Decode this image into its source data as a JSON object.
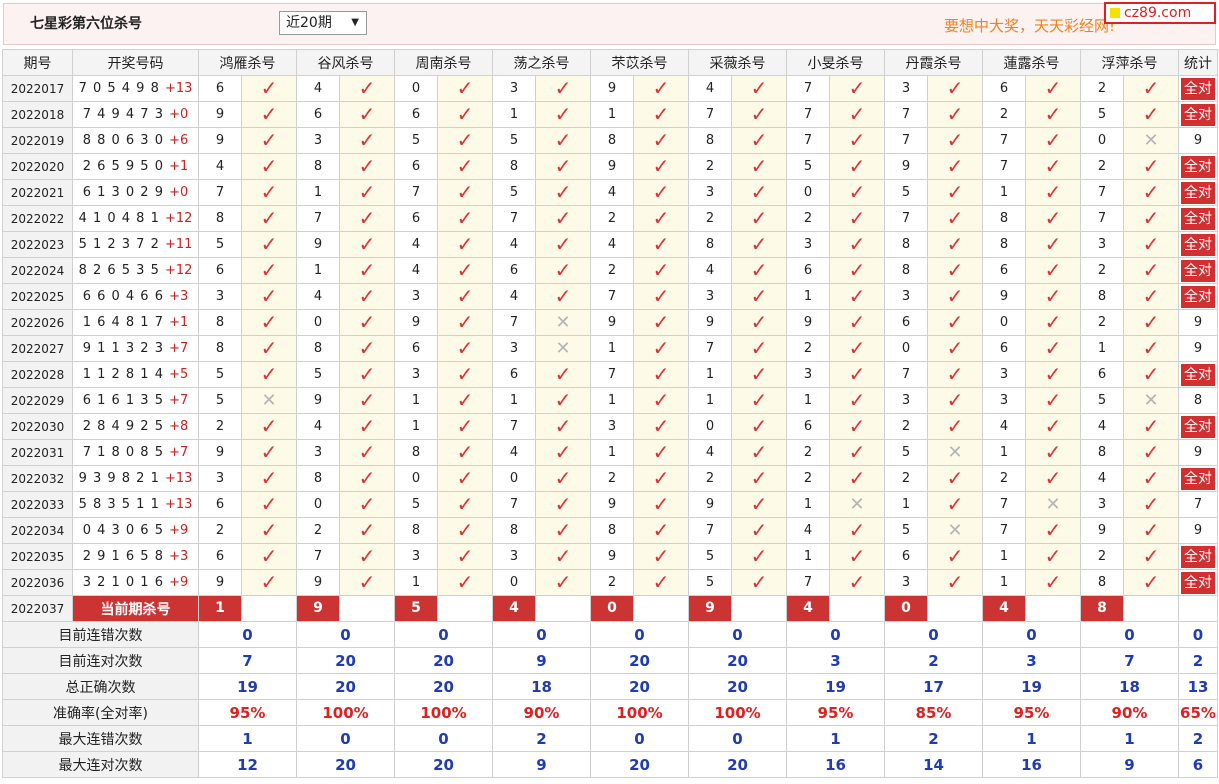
{
  "header": {
    "title": "七星彩第六位杀号",
    "period_select": "近20期",
    "slogan": "要想中大奖，天天彩经网!",
    "logo": "cz89.com"
  },
  "table": {
    "col_issue": "期号",
    "col_draw": "开奖号码",
    "col_stat": "统计",
    "experts": [
      "鸿雁杀号",
      "谷风杀号",
      "周南杀号",
      "荡之杀号",
      "芣苡杀号",
      "采薇杀号",
      "小旻杀号",
      "丹霞杀号",
      "蓮露杀号",
      "浮萍杀号"
    ],
    "rows": [
      {
        "issue": "2022017",
        "draw": "7 0 5 4 9 8",
        "sum": "+13",
        "preds": [
          "6",
          "4",
          "0",
          "3",
          "9",
          "4",
          "7",
          "3",
          "6",
          "2"
        ],
        "marks": "1111111111",
        "stat": "全对"
      },
      {
        "issue": "2022018",
        "draw": "7 4 9 4 7 3",
        "sum": "+0",
        "preds": [
          "9",
          "6",
          "6",
          "1",
          "1",
          "7",
          "7",
          "7",
          "2",
          "5"
        ],
        "marks": "1111111111",
        "stat": "全对"
      },
      {
        "issue": "2022019",
        "draw": "8 8 0 6 3 0",
        "sum": "+6",
        "preds": [
          "9",
          "3",
          "5",
          "5",
          "8",
          "8",
          "7",
          "7",
          "7",
          "0"
        ],
        "marks": "1111111110",
        "stat": "9"
      },
      {
        "issue": "2022020",
        "draw": "2 6 5 9 5 0",
        "sum": "+1",
        "preds": [
          "4",
          "8",
          "6",
          "8",
          "9",
          "2",
          "5",
          "9",
          "7",
          "2"
        ],
        "marks": "1111111111",
        "stat": "全对"
      },
      {
        "issue": "2022021",
        "draw": "6 1 3 0 2 9",
        "sum": "+0",
        "preds": [
          "7",
          "1",
          "7",
          "5",
          "4",
          "3",
          "0",
          "5",
          "1",
          "7"
        ],
        "marks": "1111111111",
        "stat": "全对"
      },
      {
        "issue": "2022022",
        "draw": "4 1 0 4 8 1",
        "sum": "+12",
        "preds": [
          "8",
          "7",
          "6",
          "7",
          "2",
          "2",
          "2",
          "7",
          "8",
          "7"
        ],
        "marks": "1111111111",
        "stat": "全对"
      },
      {
        "issue": "2022023",
        "draw": "5 1 2 3 7 2",
        "sum": "+11",
        "preds": [
          "5",
          "9",
          "4",
          "4",
          "4",
          "8",
          "3",
          "8",
          "8",
          "3"
        ],
        "marks": "1111111111",
        "stat": "全对"
      },
      {
        "issue": "2022024",
        "draw": "8 2 6 5 3 5",
        "sum": "+12",
        "preds": [
          "6",
          "1",
          "4",
          "6",
          "2",
          "4",
          "6",
          "8",
          "6",
          "2"
        ],
        "marks": "1111111111",
        "stat": "全对"
      },
      {
        "issue": "2022025",
        "draw": "6 6 0 4 6 6",
        "sum": "+3",
        "preds": [
          "3",
          "4",
          "3",
          "4",
          "7",
          "3",
          "1",
          "3",
          "9",
          "8"
        ],
        "marks": "1111111111",
        "stat": "全对"
      },
      {
        "issue": "2022026",
        "draw": "1 6 4 8 1 7",
        "sum": "+1",
        "preds": [
          "8",
          "0",
          "9",
          "7",
          "9",
          "9",
          "9",
          "6",
          "0",
          "2"
        ],
        "marks": "1110111111",
        "stat": "9"
      },
      {
        "issue": "2022027",
        "draw": "9 1 1 3 2 3",
        "sum": "+7",
        "preds": [
          "8",
          "8",
          "6",
          "3",
          "1",
          "7",
          "2",
          "0",
          "6",
          "1"
        ],
        "marks": "1110111111",
        "stat": "9"
      },
      {
        "issue": "2022028",
        "draw": "1 1 2 8 1 4",
        "sum": "+5",
        "preds": [
          "5",
          "5",
          "3",
          "6",
          "7",
          "1",
          "3",
          "7",
          "3",
          "6"
        ],
        "marks": "1111111111",
        "stat": "全对"
      },
      {
        "issue": "2022029",
        "draw": "6 1 6 1 3 5",
        "sum": "+7",
        "preds": [
          "5",
          "9",
          "1",
          "1",
          "1",
          "1",
          "1",
          "3",
          "3",
          "5"
        ],
        "marks": "0111111110",
        "stat": "8"
      },
      {
        "issue": "2022030",
        "draw": "2 8 4 9 2 5",
        "sum": "+8",
        "preds": [
          "2",
          "4",
          "1",
          "7",
          "3",
          "0",
          "6",
          "2",
          "4",
          "4"
        ],
        "marks": "1111111111",
        "stat": "全对"
      },
      {
        "issue": "2022031",
        "draw": "7 1 8 0 8 5",
        "sum": "+7",
        "preds": [
          "9",
          "3",
          "8",
          "4",
          "1",
          "4",
          "2",
          "5",
          "1",
          "8"
        ],
        "marks": "1111111011",
        "stat": "9"
      },
      {
        "issue": "2022032",
        "draw": "9 3 9 8 2 1",
        "sum": "+13",
        "preds": [
          "3",
          "8",
          "0",
          "0",
          "2",
          "2",
          "2",
          "2",
          "2",
          "4"
        ],
        "marks": "1111111111",
        "stat": "全对"
      },
      {
        "issue": "2022033",
        "draw": "5 8 3 5 1 1",
        "sum": "+13",
        "preds": [
          "6",
          "0",
          "5",
          "7",
          "9",
          "9",
          "1",
          "1",
          "7",
          "3"
        ],
        "marks": "1111110101",
        "stat": "7"
      },
      {
        "issue": "2022034",
        "draw": "0 4 3 0 6 5",
        "sum": "+9",
        "preds": [
          "2",
          "2",
          "8",
          "8",
          "8",
          "7",
          "4",
          "5",
          "7",
          "9"
        ],
        "marks": "1111111011",
        "stat": "9"
      },
      {
        "issue": "2022035",
        "draw": "2 9 1 6 5 8",
        "sum": "+3",
        "preds": [
          "6",
          "7",
          "3",
          "3",
          "9",
          "5",
          "1",
          "6",
          "1",
          "2"
        ],
        "marks": "1111111111",
        "stat": "全对"
      },
      {
        "issue": "2022036",
        "draw": "3 2 1 0 1 6",
        "sum": "+9",
        "preds": [
          "9",
          "9",
          "1",
          "0",
          "2",
          "5",
          "7",
          "3",
          "1",
          "8"
        ],
        "marks": "1111111111",
        "stat": "全对"
      }
    ],
    "current": {
      "issue": "2022037",
      "label": "当前期杀号",
      "preds": [
        "1",
        "9",
        "5",
        "4",
        "0",
        "9",
        "4",
        "0",
        "4",
        "8"
      ]
    },
    "stats": [
      {
        "label": "目前连错次数",
        "values": [
          "0",
          "0",
          "0",
          "0",
          "0",
          "0",
          "0",
          "0",
          "0",
          "0"
        ],
        "total": "0",
        "color": "blue"
      },
      {
        "label": "目前连对次数",
        "values": [
          "7",
          "20",
          "20",
          "9",
          "20",
          "20",
          "3",
          "2",
          "3",
          "7"
        ],
        "total": "2",
        "color": "blue"
      },
      {
        "label": "总正确次数",
        "values": [
          "19",
          "20",
          "20",
          "18",
          "20",
          "20",
          "19",
          "17",
          "19",
          "18"
        ],
        "total": "13",
        "color": "blue"
      },
      {
        "label": "准确率(全对率)",
        "values": [
          "95%",
          "100%",
          "100%",
          "90%",
          "100%",
          "100%",
          "95%",
          "85%",
          "95%",
          "90%"
        ],
        "total": "65%",
        "color": "red"
      },
      {
        "label": "最大连错次数",
        "values": [
          "1",
          "0",
          "0",
          "2",
          "0",
          "0",
          "1",
          "2",
          "1",
          "1"
        ],
        "total": "2",
        "color": "blue"
      },
      {
        "label": "最大连对次数",
        "values": [
          "12",
          "20",
          "20",
          "9",
          "20",
          "20",
          "16",
          "14",
          "16",
          "9"
        ],
        "total": "6",
        "color": "blue"
      }
    ]
  },
  "icons": {
    "correct": "check-icon",
    "wrong": "cross-icon"
  },
  "colors": {
    "accent_red": "#cc3333",
    "correct_mark": "#e03030",
    "stat_blue": "#1f3bb5",
    "slogan": "#f08020"
  }
}
